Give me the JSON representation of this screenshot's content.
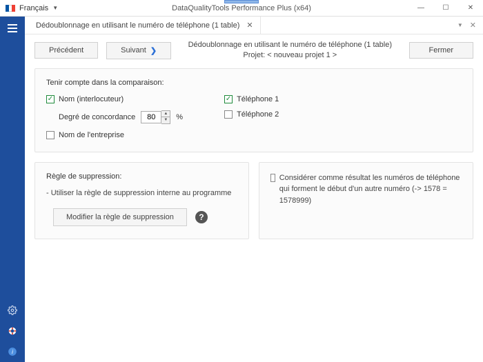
{
  "titlebar": {
    "language": "Français",
    "app_title": "DataQualityTools Performance Plus (x64)"
  },
  "sidebar": {},
  "tab": {
    "label": "Dédoublonnage en utilisant le numéro de téléphone (1 table)"
  },
  "toolbar": {
    "prev_label": "Précédent",
    "next_label": "Suivant",
    "heading": "Dédoublonnage en utilisant le numéro de téléphone (1 table)",
    "project_line": "Projet: < nouveau projet 1 >",
    "close_label": "Fermer"
  },
  "comparison": {
    "title": "Tenir compte dans la comparaison:",
    "name_contact": "Nom (interlocuteur)",
    "match_degree_label": "Degré de concordance",
    "match_degree_value": "80",
    "percent": "%",
    "company_name": "Nom de l'entreprise",
    "phone1": "Téléphone 1",
    "phone2": "Téléphone 2"
  },
  "delete_rule": {
    "title": "Règle de suppression:",
    "text": "- Utiliser la règle de suppression interne au programme",
    "modify_label": "Modifier la règle de suppression"
  },
  "consider": {
    "text": "Considérer comme résultat les numéros de téléphone qui forment le début d'un autre numéro  (-> 1578 = 1578999)"
  }
}
